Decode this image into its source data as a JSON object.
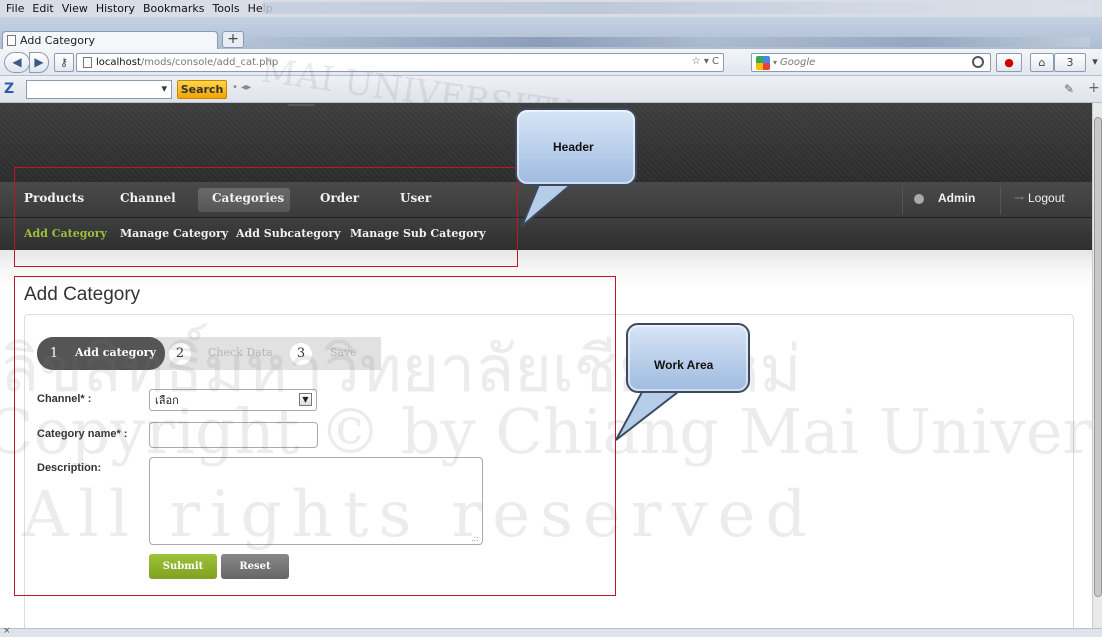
{
  "browser": {
    "menu": [
      "File",
      "Edit",
      "View",
      "History",
      "Bookmarks",
      "Tools",
      "Help"
    ],
    "tab_title": "Add Category",
    "url_host": "localhost",
    "url_path": "/mods/console/add_cat.php",
    "search_engine": "Google",
    "toolbar_search_label": "Search",
    "badge_count": "3"
  },
  "app": {
    "main_nav": [
      "Products",
      "Channel",
      "Categories",
      "Order",
      "User"
    ],
    "active_main": "Categories",
    "user_name": "Admin",
    "logout_label": "Logout",
    "sub_nav": [
      "Add Category",
      "Manage Category",
      "Add Subcategory",
      "Manage Sub Category"
    ],
    "active_sub": "Add Category",
    "accent_color": "#9dbf3a"
  },
  "page": {
    "title": "Add Category",
    "steps": [
      {
        "num": "1",
        "label": "Add category"
      },
      {
        "num": "2",
        "label": "Check Data"
      },
      {
        "num": "3",
        "label": "Save"
      }
    ],
    "form": {
      "channel_label": "Channel* :",
      "channel_value": "เลือก",
      "category_label": "Category name* :",
      "description_label": "Description:",
      "submit_label": "Submit",
      "reset_label": "Reset"
    }
  },
  "annotations": {
    "header_callout": "Header",
    "work_area_callout": "Work Area"
  },
  "watermark": {
    "line1": "ลิขสิทธิ์มหาวิทยาลัยเชียงใหม่",
    "line2": "Copyright © by Chiang Mai University",
    "line3": "All rights reserved",
    "seal_text": "MAI UNIVERSITY"
  }
}
